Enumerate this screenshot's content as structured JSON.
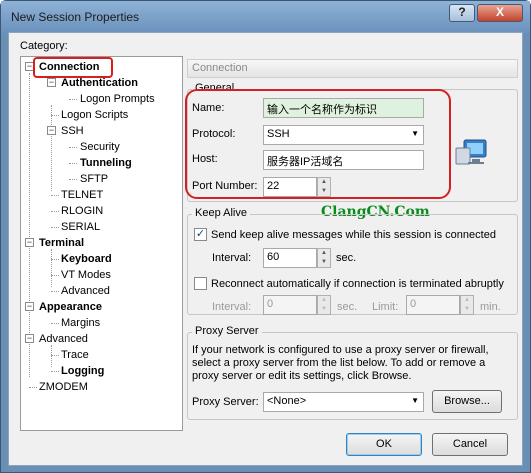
{
  "window": {
    "title": "New Session Properties",
    "help_label": "?",
    "close_label": "X"
  },
  "category_label": "Category:",
  "tree": {
    "toggle_open": "−",
    "items": [
      {
        "label": "Connection"
      },
      {
        "label": "Authentication"
      },
      {
        "label": "Logon Prompts"
      },
      {
        "label": "Logon Scripts"
      },
      {
        "label": "SSH"
      },
      {
        "label": "Security"
      },
      {
        "label": "Tunneling"
      },
      {
        "label": "SFTP"
      },
      {
        "label": "TELNET"
      },
      {
        "label": "RLOGIN"
      },
      {
        "label": "SERIAL"
      },
      {
        "label": "Terminal"
      },
      {
        "label": "Keyboard"
      },
      {
        "label": "VT Modes"
      },
      {
        "label": "Advanced"
      },
      {
        "label": "Appearance"
      },
      {
        "label": "Margins"
      },
      {
        "label": "Advanced"
      },
      {
        "label": "Trace"
      },
      {
        "label": "Logging"
      },
      {
        "label": "ZMODEM"
      }
    ]
  },
  "panel": {
    "header": "Connection",
    "general": {
      "title": "General",
      "name_label": "Name:",
      "name_value": "输入一个名称作为标识",
      "protocol_label": "Protocol:",
      "protocol_value": "SSH",
      "host_label": "Host:",
      "host_value": "服务器IP活域名",
      "port_label": "Port Number:",
      "port_value": "22"
    },
    "watermark": "ClangCN.Com",
    "keepalive": {
      "title": "Keep Alive",
      "send_label": "Send keep alive messages while this session is connected",
      "send_checked": "✓",
      "interval_label": "Interval:",
      "interval_value": "60",
      "sec_label": "sec.",
      "reconnect_label": "Reconnect automatically if connection is terminated abruptly",
      "reconnect_interval_label": "Interval:",
      "reconnect_interval_value": "0",
      "reconnect_sec_label": "sec.",
      "limit_label": "Limit:",
      "limit_value": "0",
      "min_label": "min."
    },
    "proxy": {
      "title": "Proxy Server",
      "description_1": "If your network is configured to use a proxy server or firewall,",
      "description_2": "select a proxy server from the list below. To add or remove a",
      "description_3": "proxy server or edit its settings, click Browse.",
      "server_label": "Proxy Server:",
      "server_value": "<None>",
      "browse_label": "Browse..."
    }
  },
  "buttons": {
    "ok": "OK",
    "cancel": "Cancel"
  },
  "colors": {
    "annotation": "#d62020",
    "watermark": "#0b8a1e"
  }
}
